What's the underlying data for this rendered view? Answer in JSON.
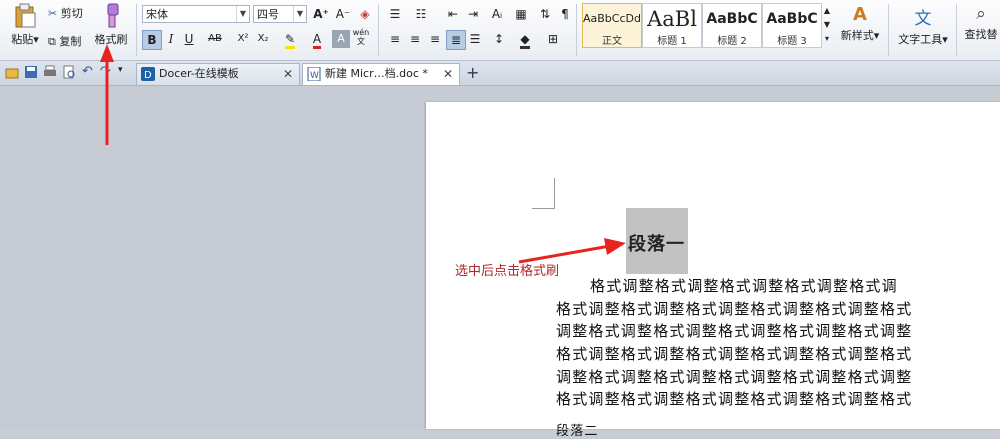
{
  "ribbon": {
    "paste": "粘贴",
    "cut": "剪切",
    "copy": "复制",
    "format_painter": "格式刷",
    "font_name": "宋体",
    "font_size": "四号",
    "styles": [
      {
        "preview": "AaBbCcDd",
        "label": "正文"
      },
      {
        "preview": "AaBl",
        "label": "标题 1"
      },
      {
        "preview": "AaBbC",
        "label": "标题 2"
      },
      {
        "preview": "AaBbC",
        "label": "标题 3"
      }
    ],
    "new_style": "新样式",
    "text_tools": "文字工具",
    "find_replace": "查找替"
  },
  "tabs": [
    {
      "label": "Docer-在线模板"
    },
    {
      "label": "新建 Micr…档.doc *"
    }
  ],
  "document": {
    "heading": "段落一",
    "annotation": "选中后点击格式刷",
    "lines": [
      "格式调整格式调整格式调整格式调整格式调",
      "格式调整格式调整格式调整格式调整格式调整格式",
      "调整格式调整格式调整格式调整格式调整格式调整",
      "格式调整格式调整格式调整格式调整格式调整格式",
      "调整格式调整格式调整格式调整格式调整格式调整",
      "格式调整格式调整格式调整格式调整格式调整格式"
    ],
    "next_para": "段落二"
  },
  "colors": {
    "accent_arrow": "#e8231e",
    "annotation": "#b3262a"
  }
}
